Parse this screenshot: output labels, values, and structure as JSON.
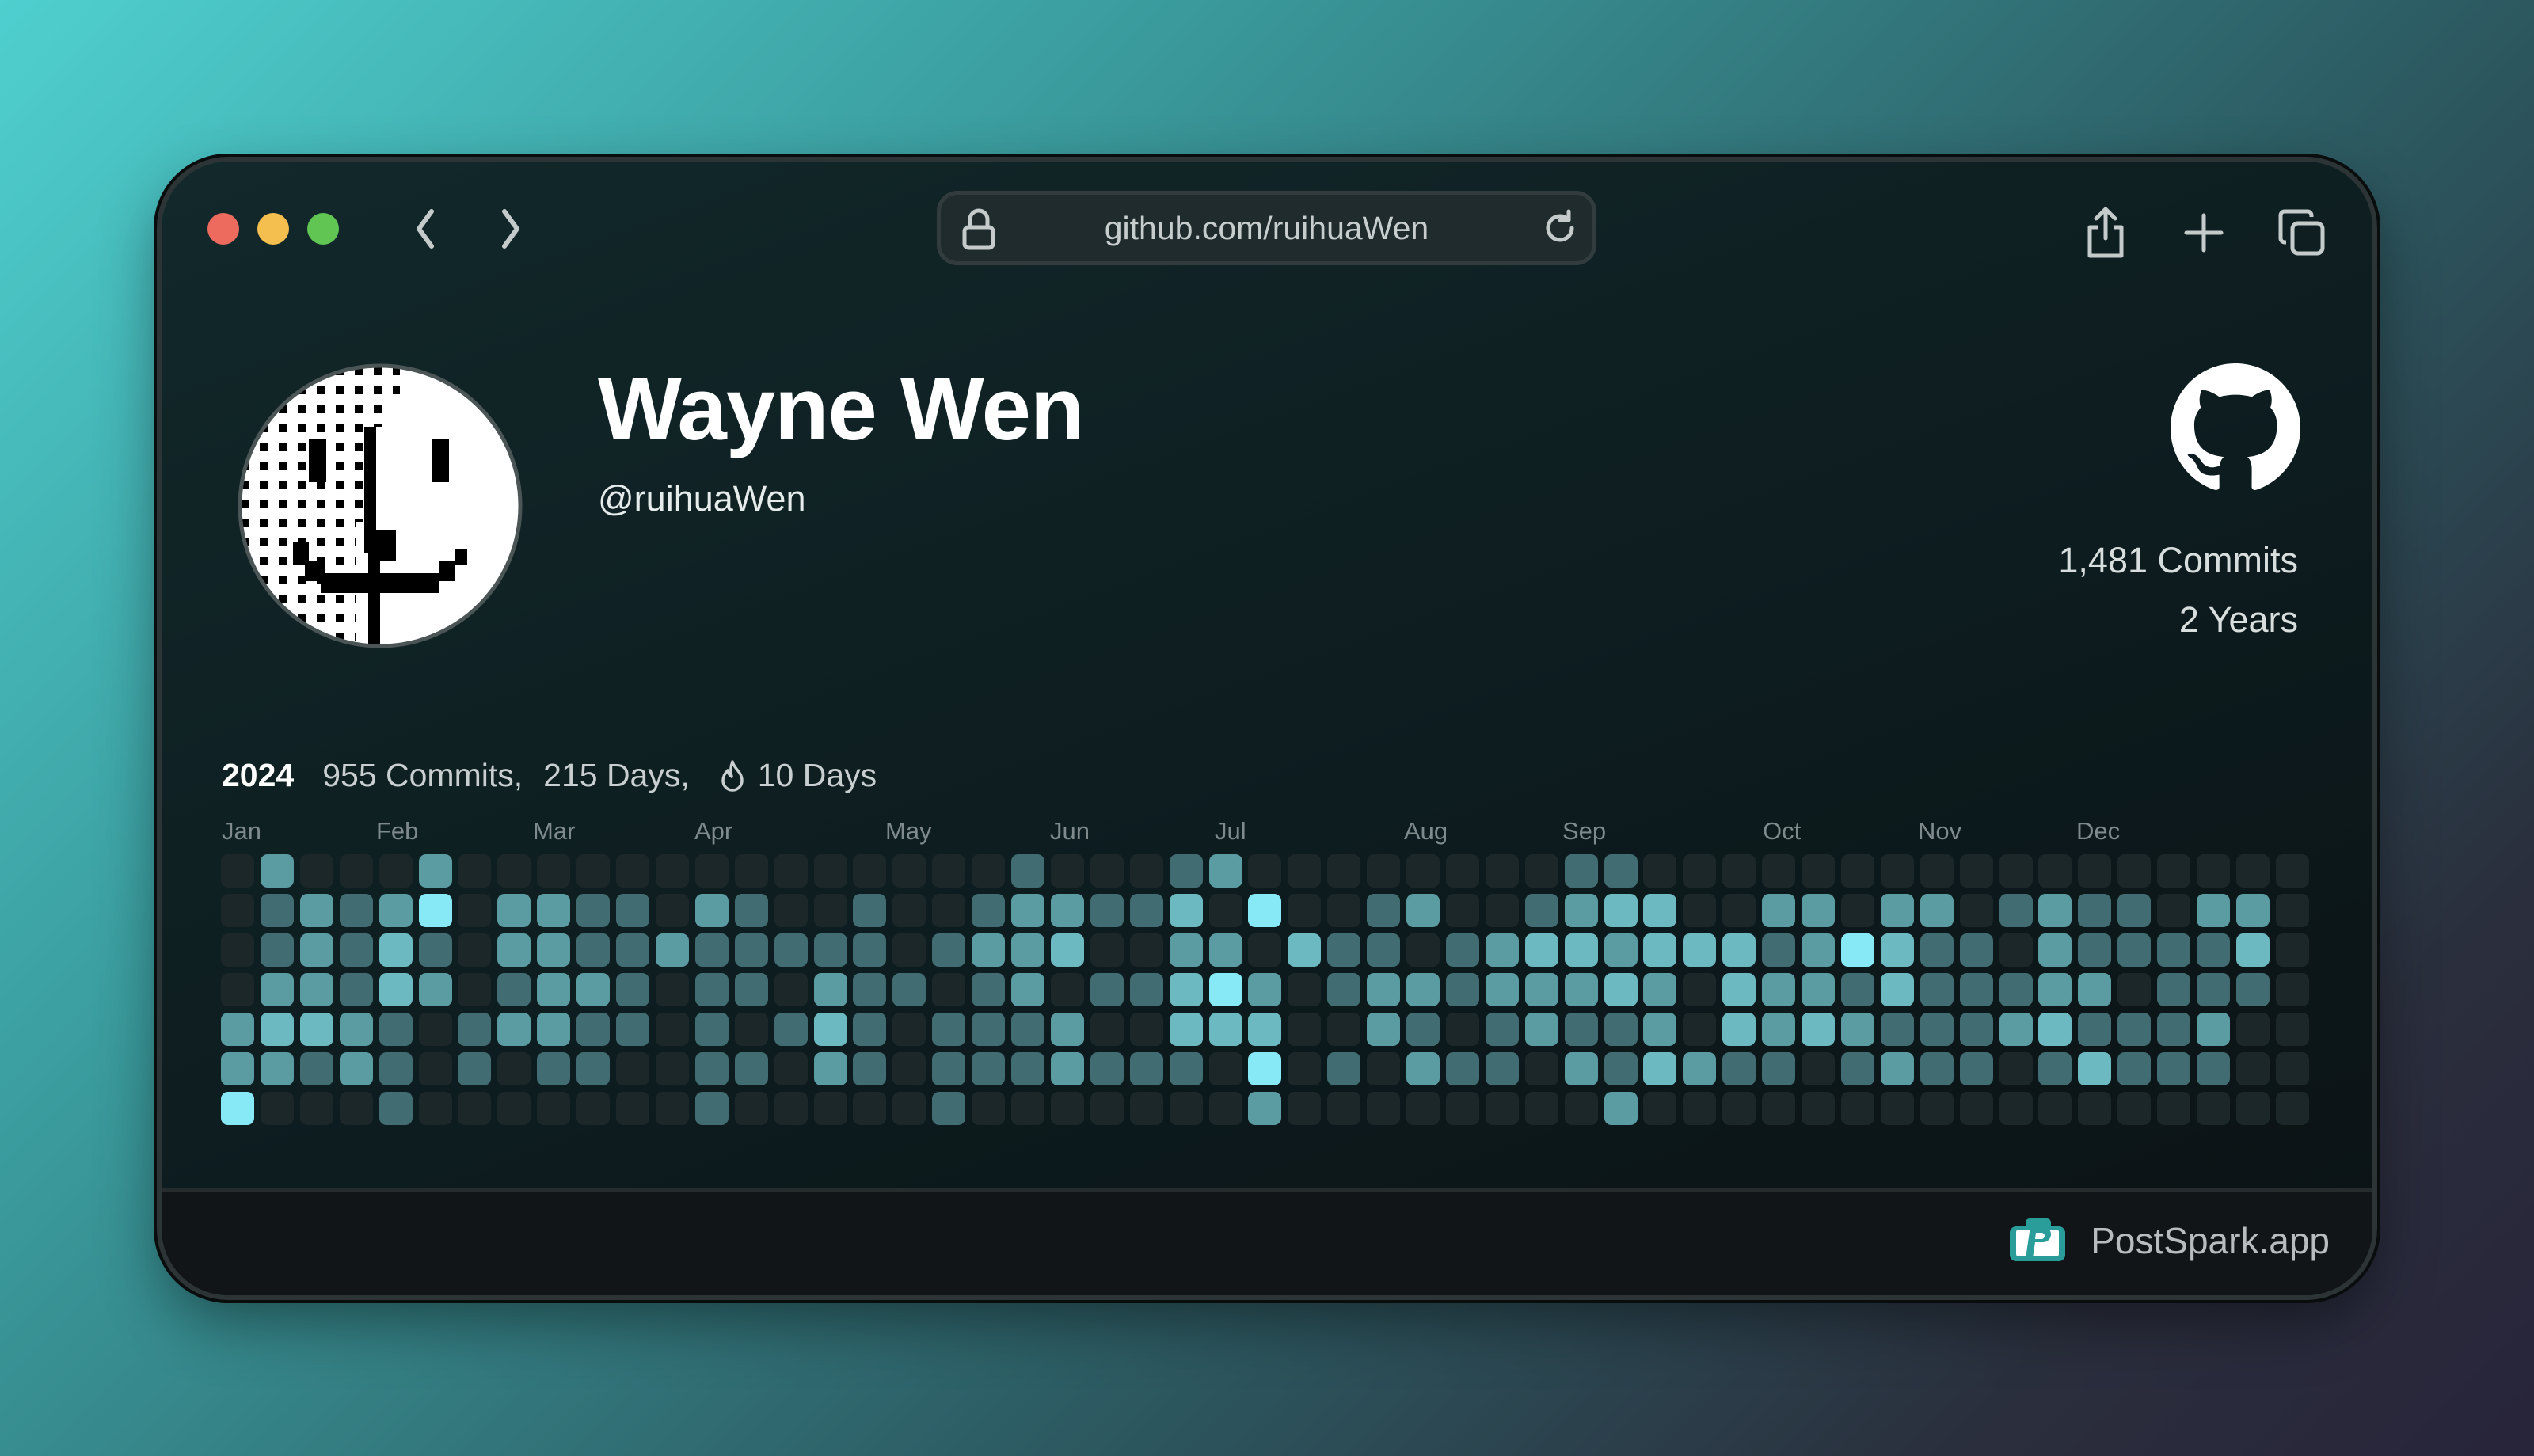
{
  "browser": {
    "url": "github.com/ruihuaWen",
    "traffic_lights": {
      "close": "#ec6a5e",
      "minimize": "#f4bf4f",
      "maximize": "#61c554"
    },
    "icons": {
      "back": "chevron-left-icon",
      "forward": "chevron-right-icon",
      "lock": "lock-icon",
      "reload": "reload-icon",
      "share": "share-icon",
      "new_tab": "plus-icon",
      "tabs": "tabs-icon"
    }
  },
  "profile": {
    "name": "Wayne Wen",
    "handle": "@ruihuaWen",
    "total_commits": "1,481 Commits",
    "years": "2 Years"
  },
  "year_stats": {
    "year": "2024",
    "commits": "955 Commits,",
    "days": "215 Days,",
    "streak_icon": "flame-icon",
    "streak": "10 Days"
  },
  "calendar": {
    "months": [
      "Jan",
      "Feb",
      "Mar",
      "Apr",
      "May",
      "Jun",
      "Jul",
      "Aug",
      "Sep",
      "Oct",
      "Nov",
      "Dec"
    ],
    "level_colors": [
      "#1b2729",
      "#416c71",
      "#5b9ba2",
      "#6cb9c1",
      "#88e9f6"
    ],
    "levels": [
      [
        0,
        2,
        0,
        0,
        0,
        2,
        0,
        0,
        0,
        0,
        0,
        0,
        0,
        0,
        0,
        0,
        0,
        0,
        0,
        0,
        1,
        0,
        0,
        0,
        1,
        2,
        0,
        0,
        0,
        0,
        0,
        0,
        0,
        0,
        1,
        1,
        0,
        0,
        0,
        0,
        0,
        0,
        0,
        0,
        0,
        0,
        0,
        0,
        0,
        0,
        0,
        0,
        0
      ],
      [
        0,
        1,
        2,
        1,
        2,
        4,
        0,
        2,
        2,
        1,
        1,
        0,
        2,
        1,
        0,
        0,
        1,
        0,
        0,
        1,
        2,
        2,
        1,
        1,
        3,
        0,
        4,
        0,
        0,
        1,
        2,
        0,
        0,
        1,
        2,
        3,
        3,
        0,
        0,
        2,
        2,
        0,
        2,
        2,
        0,
        1,
        2,
        1,
        1,
        0,
        2,
        2,
        0
      ],
      [
        0,
        1,
        2,
        1,
        3,
        1,
        0,
        2,
        2,
        1,
        1,
        2,
        1,
        1,
        1,
        1,
        1,
        0,
        1,
        2,
        2,
        3,
        0,
        0,
        2,
        2,
        0,
        3,
        1,
        1,
        0,
        1,
        2,
        3,
        3,
        2,
        3,
        3,
        3,
        1,
        2,
        4,
        3,
        1,
        1,
        0,
        2,
        1,
        1,
        1,
        1,
        3,
        0
      ],
      [
        0,
        2,
        2,
        1,
        3,
        2,
        0,
        1,
        2,
        2,
        1,
        0,
        1,
        1,
        0,
        2,
        1,
        1,
        0,
        1,
        2,
        0,
        1,
        1,
        3,
        4,
        2,
        0,
        1,
        2,
        2,
        1,
        2,
        2,
        2,
        3,
        2,
        0,
        3,
        2,
        2,
        1,
        3,
        1,
        1,
        1,
        2,
        2,
        0,
        1,
        1,
        1,
        0
      ],
      [
        2,
        3,
        3,
        2,
        1,
        0,
        1,
        2,
        2,
        1,
        1,
        0,
        1,
        0,
        1,
        3,
        1,
        0,
        1,
        1,
        1,
        2,
        0,
        0,
        3,
        3,
        3,
        0,
        0,
        2,
        1,
        0,
        1,
        2,
        1,
        1,
        2,
        0,
        3,
        2,
        3,
        2,
        1,
        1,
        1,
        2,
        3,
        1,
        1,
        1,
        2,
        0,
        0
      ],
      [
        2,
        2,
        1,
        2,
        1,
        0,
        1,
        0,
        1,
        1,
        0,
        0,
        1,
        1,
        0,
        2,
        1,
        0,
        1,
        1,
        1,
        2,
        1,
        1,
        1,
        0,
        4,
        0,
        1,
        0,
        2,
        1,
        1,
        0,
        2,
        1,
        3,
        2,
        1,
        1,
        0,
        1,
        2,
        1,
        1,
        0,
        1,
        3,
        1,
        1,
        1,
        0,
        0
      ],
      [
        4,
        0,
        0,
        0,
        1,
        0,
        0,
        0,
        0,
        0,
        0,
        0,
        1,
        0,
        0,
        0,
        0,
        0,
        1,
        0,
        0,
        0,
        0,
        0,
        0,
        0,
        2,
        0,
        0,
        0,
        0,
        0,
        0,
        0,
        0,
        2,
        0,
        0,
        0,
        0,
        0,
        0,
        0,
        0,
        0,
        0,
        0,
        0,
        0,
        0,
        0,
        0,
        0
      ]
    ]
  },
  "footer": {
    "brand": "PostSpark.app",
    "brand_color": "#2a9d9a"
  }
}
